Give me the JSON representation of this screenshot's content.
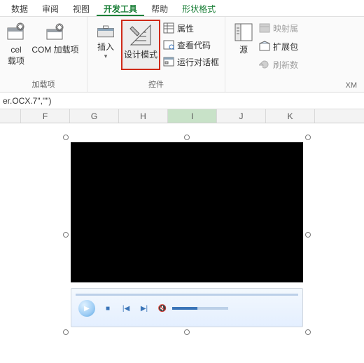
{
  "tabs": {
    "items": [
      {
        "label": "数据"
      },
      {
        "label": "审阅"
      },
      {
        "label": "视图"
      },
      {
        "label": "开发工具"
      },
      {
        "label": "帮助"
      },
      {
        "label": "形状格式"
      }
    ],
    "active_index": 3
  },
  "ribbon": {
    "addins": {
      "excel_addin_top": "cel",
      "excel_addin_bottom": "载项",
      "com_addin": "COM 加载项",
      "group_title": "加载项"
    },
    "controls": {
      "insert": "插入",
      "design_mode": "设计模式",
      "properties": "属性",
      "view_code": "查看代码",
      "run_dialog": "运行对话框",
      "group_title": "控件"
    },
    "xml": {
      "source": "源",
      "map": "映射属",
      "expand": "扩展包",
      "refresh": "刷新数",
      "group_title": "XM"
    }
  },
  "formula_bar": {
    "text": "er.OCX.7\",\"\")"
  },
  "columns": [
    "",
    "F",
    "G",
    "H",
    "I",
    "J",
    "K"
  ],
  "selected_col_index": 4,
  "media": {
    "icon": {
      "play": "▶",
      "stop": "■",
      "prev": "|◀",
      "next": "▶|",
      "mute": "🔇"
    }
  }
}
